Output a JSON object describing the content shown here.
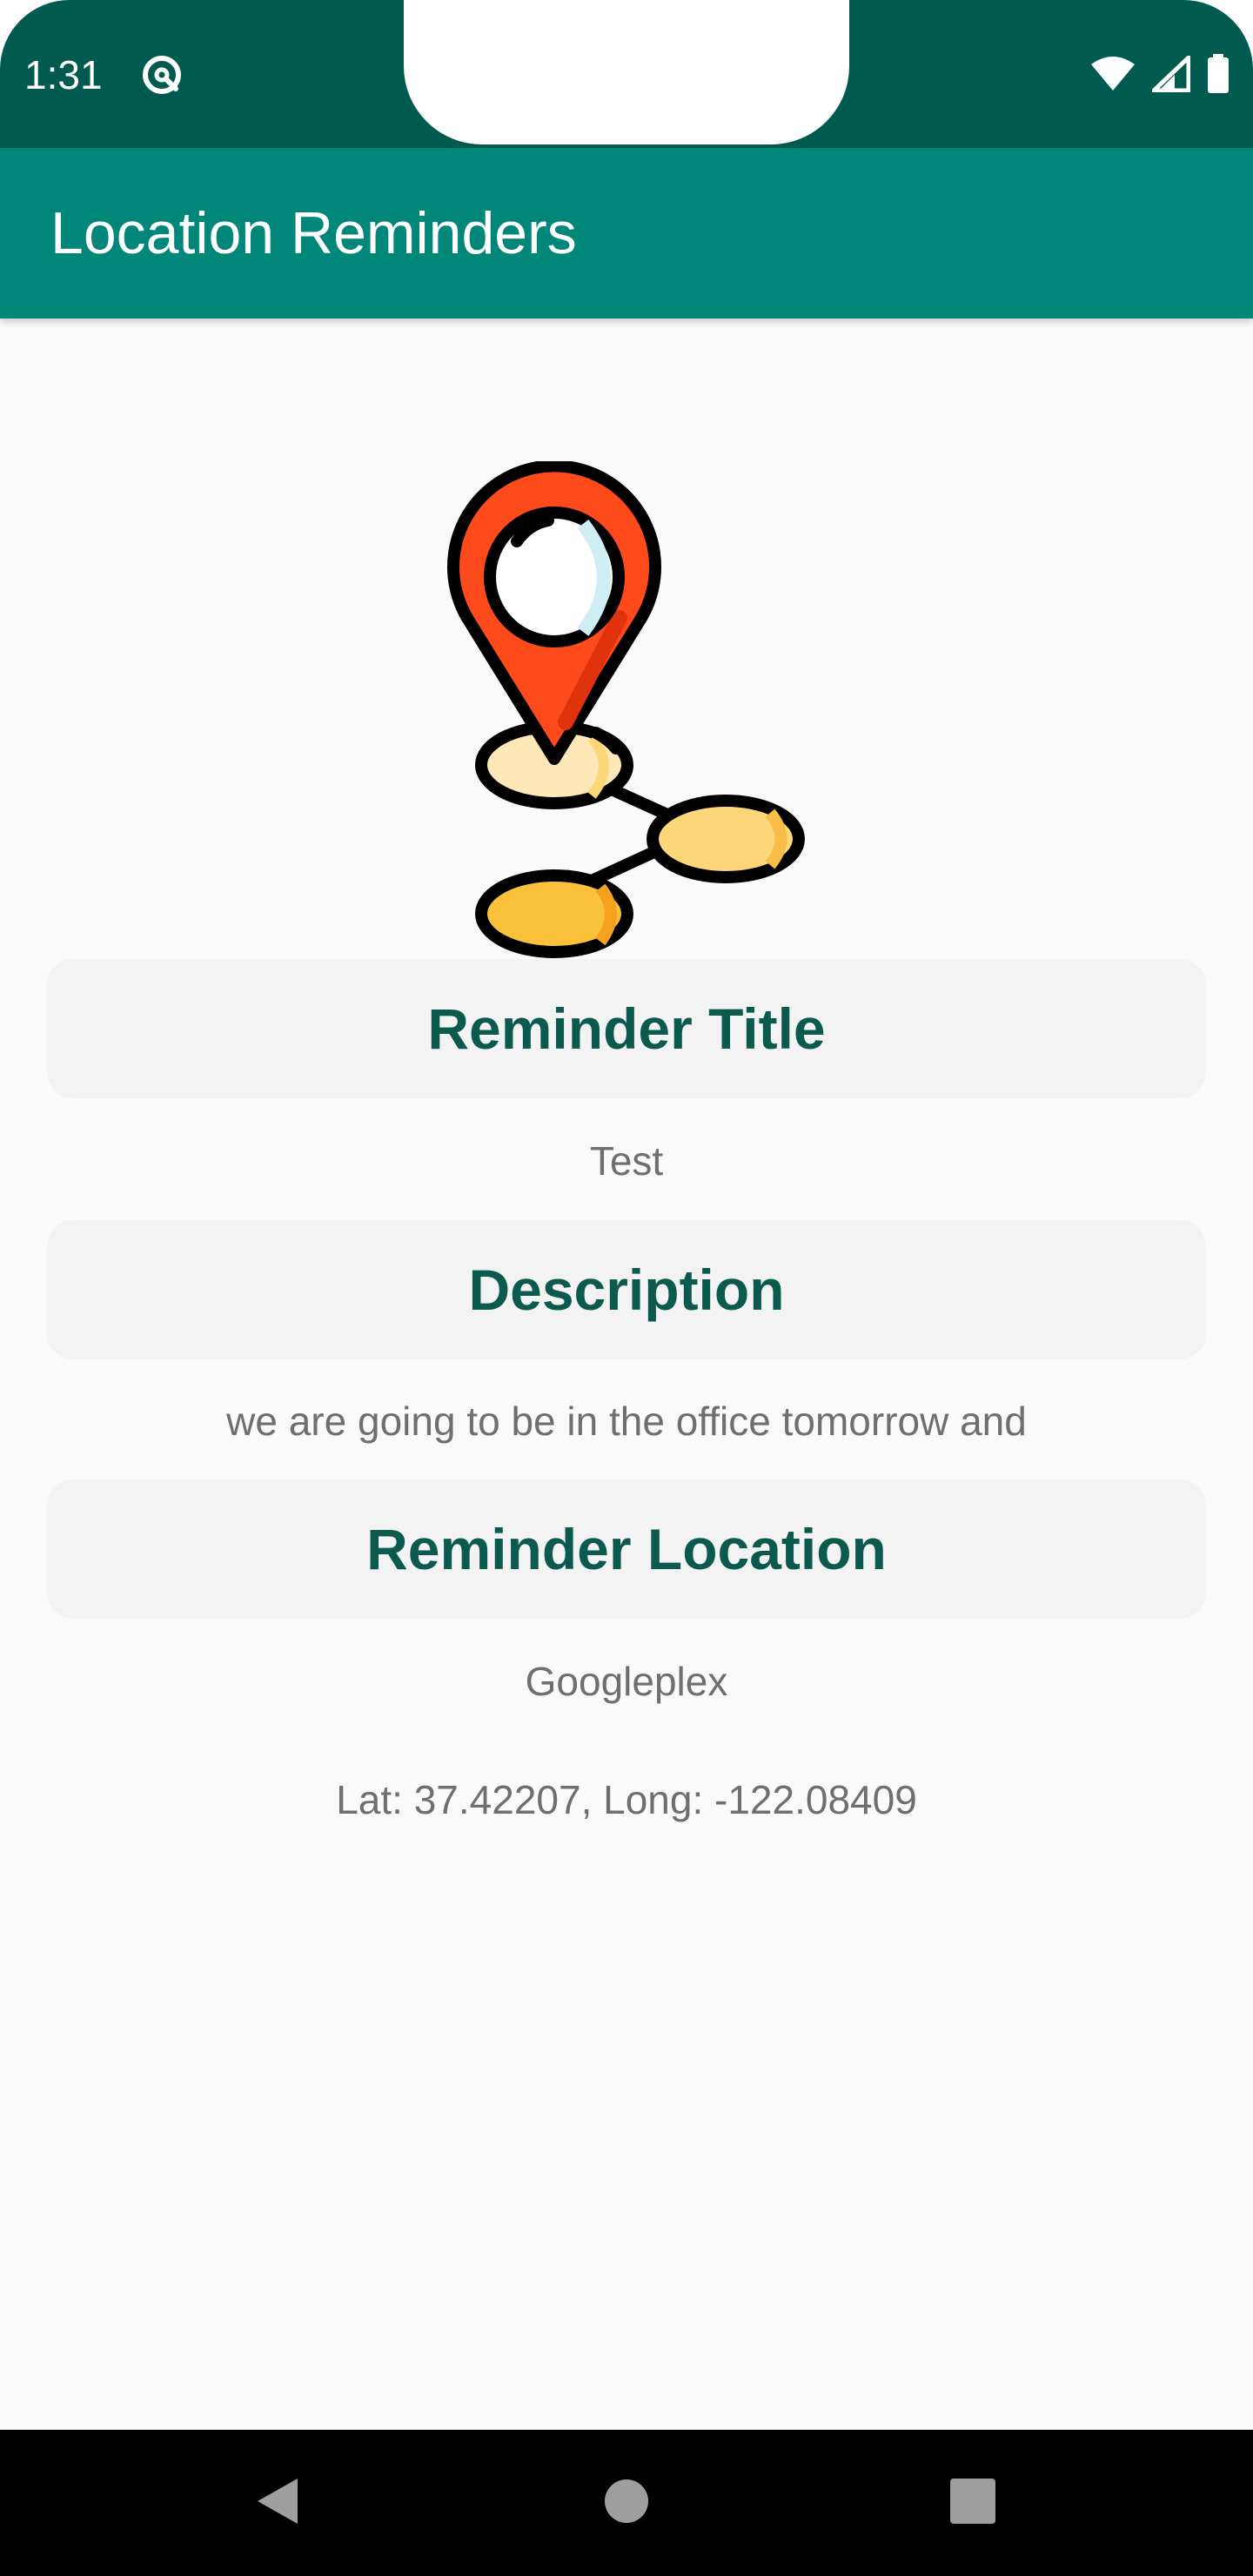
{
  "status_bar": {
    "time": "1:31"
  },
  "app_bar": {
    "title": "Location Reminders"
  },
  "sections": {
    "title": {
      "header": "Reminder Title",
      "value": "Test"
    },
    "description": {
      "header": "Description",
      "value": "we are going to be in the office tomorrow and"
    },
    "location": {
      "header": "Reminder Location",
      "value": "Googleplex",
      "coordinates": "Lat: 37.42207, Long: -122.08409"
    }
  },
  "colors": {
    "status_bar": "#005a4f",
    "app_bar": "#00877a",
    "header_text": "#0b5a4d",
    "value_text": "#6f6f6f",
    "pin": "#ff4a1c"
  },
  "icons": {
    "status": [
      "data-saver-icon",
      "wifi-icon",
      "signal-icon",
      "battery-icon"
    ],
    "illustration": "location-pin-route-icon",
    "nav": [
      "back-icon",
      "home-icon",
      "recents-icon"
    ]
  }
}
